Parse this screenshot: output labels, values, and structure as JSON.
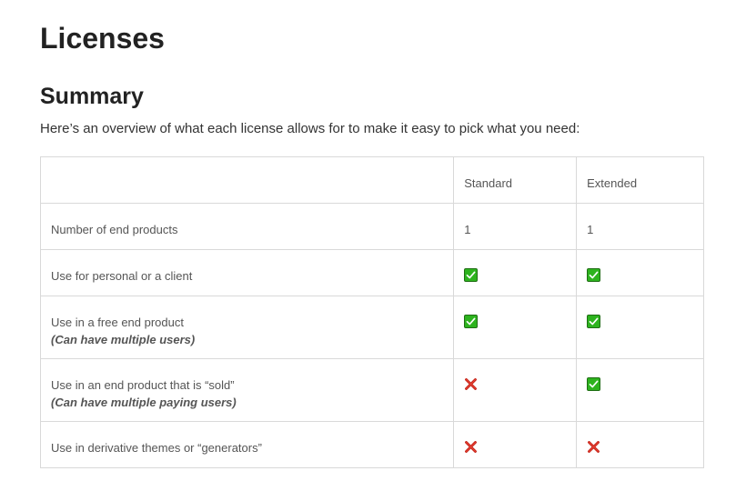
{
  "page": {
    "title": "Licenses",
    "section_title": "Summary",
    "intro": "Here’s an overview of what each license allows for to make it easy to pick what you need:"
  },
  "table": {
    "headers": [
      "",
      "Standard",
      "Extended"
    ],
    "rows": [
      {
        "feature": "Number of end products",
        "note": "",
        "standard": "1",
        "extended": "1"
      },
      {
        "feature": "Use for personal or a client",
        "note": "",
        "standard": "check-icon",
        "extended": "check-icon"
      },
      {
        "feature": "Use in a free end product",
        "note": "(Can have multiple users)",
        "standard": "check-icon",
        "extended": "check-icon"
      },
      {
        "feature": "Use in an end product that is “sold”",
        "note": "(Can have multiple paying users)",
        "standard": "cross-icon",
        "extended": "check-icon"
      },
      {
        "feature": "Use in derivative themes or “generators”",
        "note": "",
        "standard": "cross-icon",
        "extended": "cross-icon"
      }
    ]
  },
  "colors": {
    "check_fill": "#2db31e",
    "check_border": "#1f6e14",
    "cross": "#c21b0f",
    "border": "#d9d9d9"
  }
}
